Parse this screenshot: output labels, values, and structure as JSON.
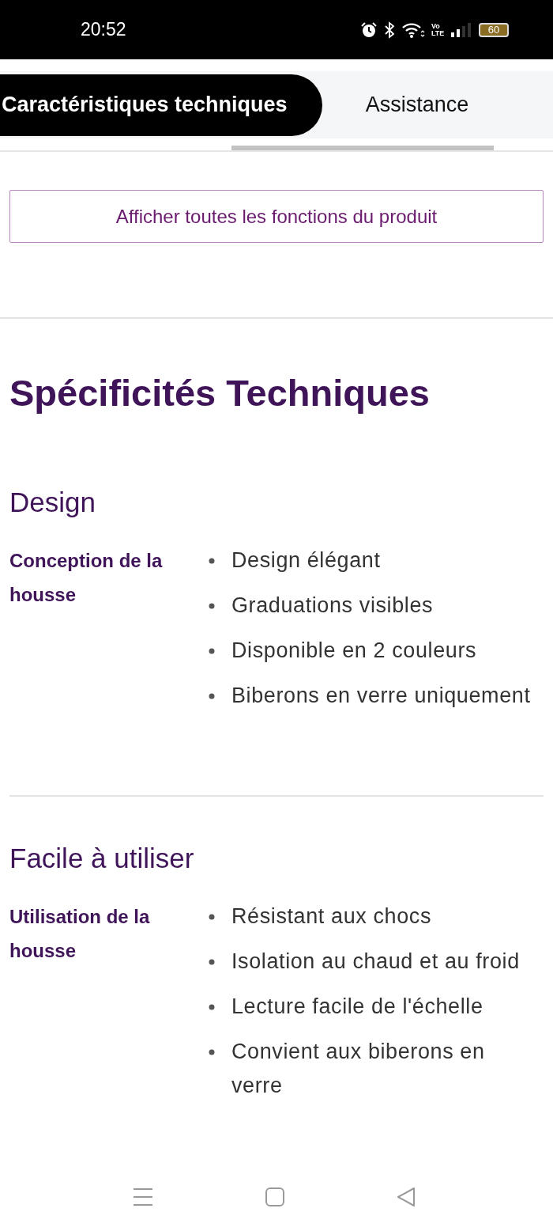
{
  "status_bar": {
    "time": "20:52",
    "network_label": "Vo\nLTE",
    "battery": "60"
  },
  "tabs": [
    {
      "label": "Caractéristiques techniques",
      "selected": true
    },
    {
      "label": "Assistance",
      "selected": false
    }
  ],
  "show_all_button": "Afficher toutes les fonctions du produit",
  "title": "Spécificités Techniques",
  "sections": [
    {
      "heading": "Design",
      "label": "Conception de la housse",
      "items": [
        "Design élégant",
        "Graduations visibles",
        "Disponible en 2 couleurs",
        "Biberons en verre uniquement"
      ]
    },
    {
      "heading": "Facile à utiliser",
      "label": "Utilisation de la housse",
      "items": [
        "Résistant aux chocs",
        "Isolation au chaud et au froid",
        "Lecture facile de l'échelle",
        "Convient aux biberons en verre"
      ]
    }
  ]
}
